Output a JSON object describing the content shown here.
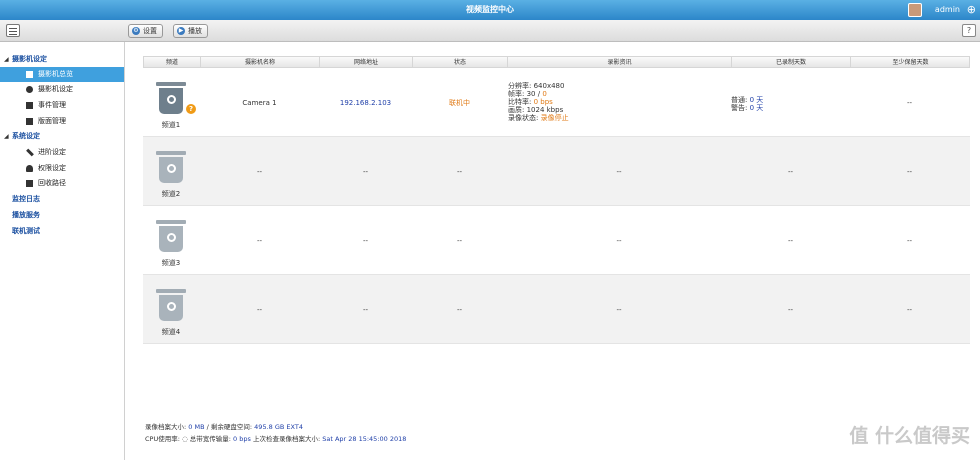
{
  "window": {
    "title": "视频监控中心",
    "user": "admin"
  },
  "toolbar": {
    "settings_label": "设置",
    "play_label": "播放"
  },
  "sidebar": {
    "camera_settings": "摄影机设定",
    "camera_overview": "摄影机总览",
    "camera_config": "摄影机设定",
    "event_mgmt": "事件管理",
    "screen_mgmt": "版面管理",
    "system_settings": "系统设定",
    "advanced": "进阶设定",
    "privilege": "权限设定",
    "recycle": "回收路径",
    "monitor_log": "监控日志",
    "playback": "播放服务",
    "online_test": "联机测试"
  },
  "table": {
    "headers": [
      "频道",
      "摄影机名称",
      "网络地址",
      "状态",
      "录影资讯",
      "已录制天数",
      "至少保留天数"
    ],
    "rows": [
      {
        "channel": "频道1",
        "name": "Camera 1",
        "ip": "192.168.2.103",
        "status": "联机中",
        "res_label": "分辨率:",
        "res": "640x480",
        "fps_label": "帧率:",
        "fps": "30 /",
        "fps2": "0",
        "bitrate_label": "比特率:",
        "bitrate": "0 bps",
        "stream_label": "画质:",
        "stream": "1024 kbps",
        "recstate_label": "录像状态:",
        "recstate": "录像停止",
        "normal_label": "普通:",
        "normal": "0 天",
        "alarm_label": "警告:",
        "alarm": "0 天",
        "keep": "--"
      },
      {
        "channel": "频道2",
        "name": "--",
        "ip": "--",
        "status": "--",
        "rec": "--",
        "days": "--",
        "keep": "--"
      },
      {
        "channel": "频道3",
        "name": "--",
        "ip": "--",
        "status": "--",
        "rec": "--",
        "days": "--",
        "keep": "--"
      },
      {
        "channel": "频道4",
        "name": "--",
        "ip": "--",
        "status": "--",
        "rec": "--",
        "days": "--",
        "keep": "--"
      }
    ]
  },
  "footer": {
    "line1_label": "录像档案大小:",
    "line1_value": "0 MB",
    "line1_label2": "/ 剩余硬盘空间:",
    "line1_value2": "495.8 GB EXT4",
    "line2_label": "CPU使用率:",
    "line2_label2": "总带宽传输量:",
    "line2_value": "0 bps",
    "line2_label3": "上次检查录像档案大小:",
    "line2_value3": "Sat Apr 28 15:45:00 2018"
  },
  "watermark": "值 什么值得买"
}
